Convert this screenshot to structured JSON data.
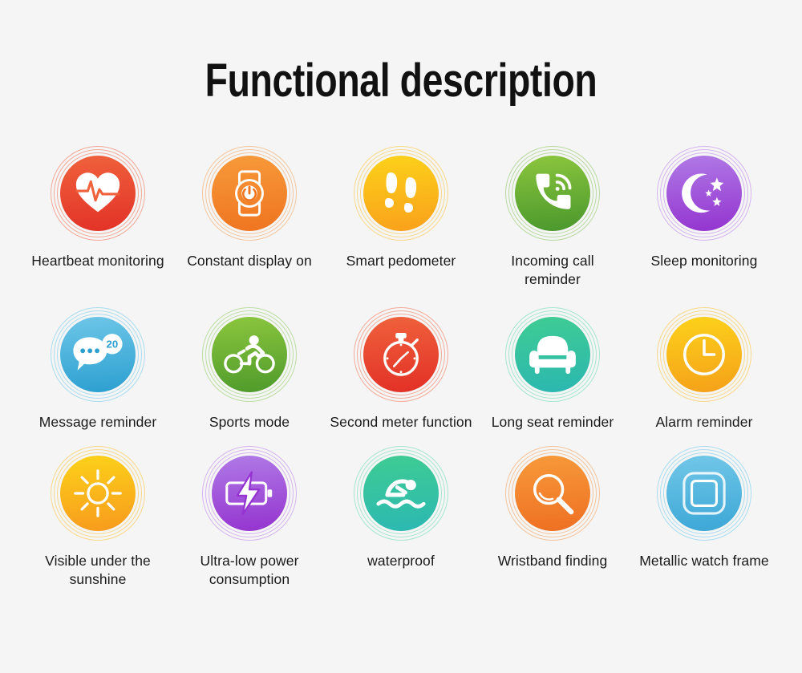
{
  "page": {
    "title": "Functional description",
    "background_color": "#f5f5f5",
    "text_color": "#1a1a1a"
  },
  "features": [
    {
      "label": "Heartbeat monitoring",
      "icon": "heart-pulse-icon",
      "color_start": "#f0623c",
      "color_end": "#e23127",
      "ring_color": "#f2a898"
    },
    {
      "label": "Constant display on",
      "icon": "watch-power-icon",
      "color_start": "#f79a3a",
      "color_end": "#ef7420",
      "ring_color": "#f4c69d"
    },
    {
      "label": "Smart pedometer",
      "icon": "footprints-icon",
      "color_start": "#fcd21a",
      "color_end": "#f9a01b",
      "ring_color": "#f8d88a"
    },
    {
      "label": "Incoming call reminder",
      "icon": "phone-call-icon",
      "color_start": "#8cc63e",
      "color_end": "#49972c",
      "ring_color": "#b9d9a0"
    },
    {
      "label": "Sleep monitoring",
      "icon": "moon-stars-icon",
      "color_start": "#b07ae6",
      "color_end": "#9333cf",
      "ring_color": "#d4b4ef"
    },
    {
      "label": "Message reminder",
      "icon": "message-bubble-icon",
      "color_start": "#6ec6e8",
      "color_end": "#2b9fd0",
      "ring_color": "#aadcef",
      "badge": "20"
    },
    {
      "label": "Sports mode",
      "icon": "cyclist-icon",
      "color_start": "#8cc63e",
      "color_end": "#4e9a2b",
      "ring_color": "#bcdda3"
    },
    {
      "label": "Second meter function",
      "icon": "stopwatch-icon",
      "color_start": "#f0623c",
      "color_end": "#e22f26",
      "ring_color": "#f3ab9b"
    },
    {
      "label": "Long seat reminder",
      "icon": "armchair-icon",
      "color_start": "#3fcc93",
      "color_end": "#2bb7b0",
      "ring_color": "#a6e6cf"
    },
    {
      "label": "Alarm reminder",
      "icon": "clock-icon",
      "color_start": "#fcd21a",
      "color_end": "#f5a019",
      "ring_color": "#f8d88a"
    },
    {
      "label": "Visible under the sunshine",
      "icon": "sun-icon",
      "color_start": "#fcd21a",
      "color_end": "#f89a1c",
      "ring_color": "#f8d88a"
    },
    {
      "label": "Ultra-low power consumption",
      "icon": "battery-bolt-icon",
      "color_start": "#b07ae6",
      "color_end": "#9433cf",
      "ring_color": "#d4b4ef"
    },
    {
      "label": "waterproof",
      "icon": "swimmer-icon",
      "color_start": "#3fcc93",
      "color_end": "#2bb8b2",
      "ring_color": "#a6e6cf"
    },
    {
      "label": "Wristband finding",
      "icon": "magnifier-icon",
      "color_start": "#f79a3a",
      "color_end": "#ee6f22",
      "ring_color": "#f4c49b"
    },
    {
      "label": "Metallic watch frame",
      "icon": "watch-frame-icon",
      "color_start": "#72c8e8",
      "color_end": "#3ba6d6",
      "ring_color": "#aadcef"
    }
  ]
}
